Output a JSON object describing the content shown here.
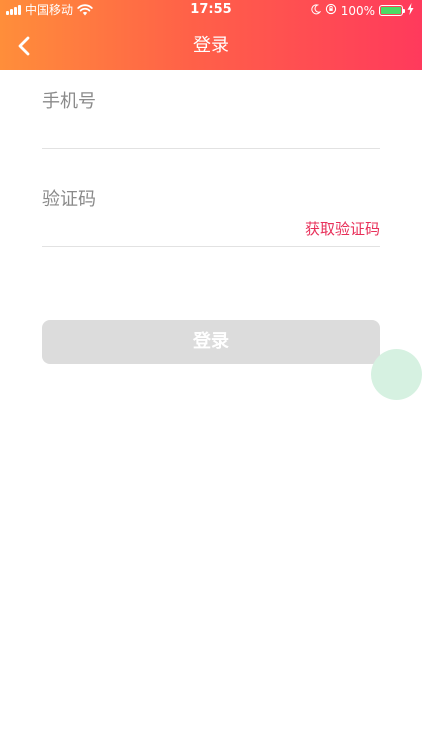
{
  "status_bar": {
    "carrier": "中国移动",
    "time": "17:55",
    "battery_percent": "100%",
    "battery_level": 1.0
  },
  "nav": {
    "back_icon": "chevron-left-icon",
    "title": "登录"
  },
  "form": {
    "phone_label": "手机号",
    "phone_value": "",
    "code_label": "验证码",
    "code_value": "",
    "get_code_label": "获取验证码",
    "submit_label": "登录"
  },
  "colors": {
    "gradient_start": "#FF8E3A",
    "gradient_end": "#FF3A5C",
    "accent_link": "#E8305A",
    "button_disabled": "#DCDCDC",
    "floating_dot": "#D6F1E1"
  }
}
